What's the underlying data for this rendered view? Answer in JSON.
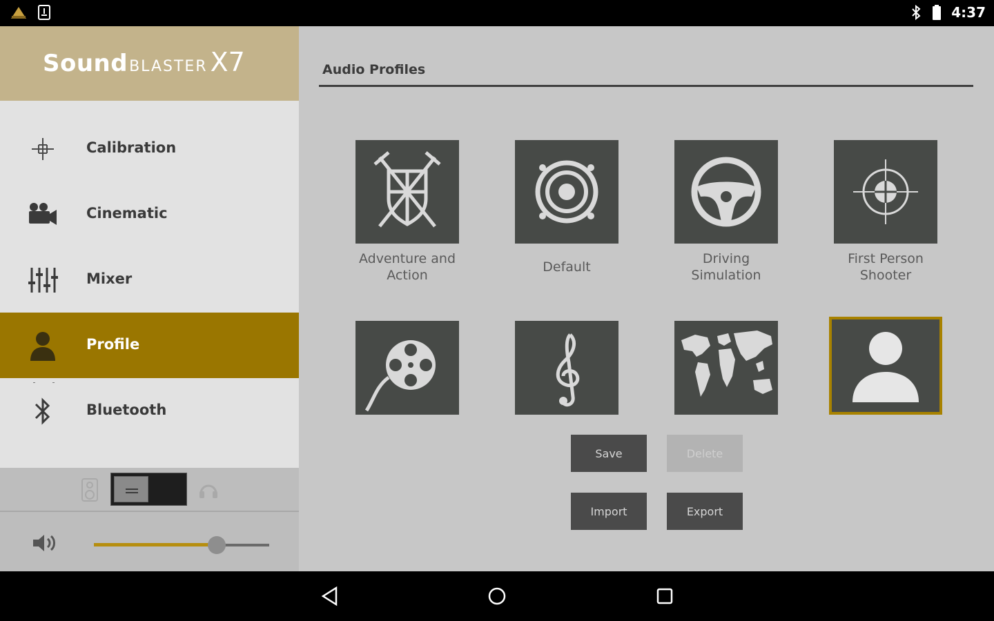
{
  "status": {
    "time": "4:37"
  },
  "brand": {
    "sound": "Sound",
    "blaster": "BLASTER",
    "model": "X7"
  },
  "sidebar": {
    "items": [
      {
        "label": "Calibration",
        "icon": "calibration-icon"
      },
      {
        "label": "Cinematic",
        "icon": "movie-camera-icon"
      },
      {
        "label": "Mixer",
        "icon": "mixer-sliders-icon"
      },
      {
        "label": "Profile",
        "icon": "person-icon",
        "active": true
      },
      {
        "label": "Bluetooth",
        "icon": "bluetooth-icon"
      }
    ],
    "output_switch": {
      "left_icon": "speaker-icon",
      "right_icon": "headphones-icon",
      "position": "speakers"
    },
    "volume": {
      "level": 0.7
    }
  },
  "main": {
    "section_title": "Audio Profiles",
    "profiles": [
      {
        "label": "Adventure and Action",
        "icon": "crossed-swords-shield-icon"
      },
      {
        "label": "Default",
        "icon": "speaker-cone-icon"
      },
      {
        "label": "Driving Simulation",
        "icon": "steering-wheel-icon"
      },
      {
        "label": "First Person Shooter",
        "icon": "crosshair-icon"
      },
      {
        "label": "",
        "icon": "film-reel-icon"
      },
      {
        "label": "",
        "icon": "treble-clef-icon"
      },
      {
        "label": "",
        "icon": "world-map-icon"
      },
      {
        "label": "",
        "icon": "user-silhouette-icon",
        "selected": true
      }
    ],
    "buttons": {
      "save": "Save",
      "delete": "Delete",
      "import": "Import",
      "export": "Export"
    }
  },
  "colors": {
    "brand_bg": "#c3b38b",
    "accent": "#9a7600",
    "tile_bg": "#474a47",
    "main_bg": "#c7c7c7",
    "sidebar_bg": "#e2e2e2"
  }
}
